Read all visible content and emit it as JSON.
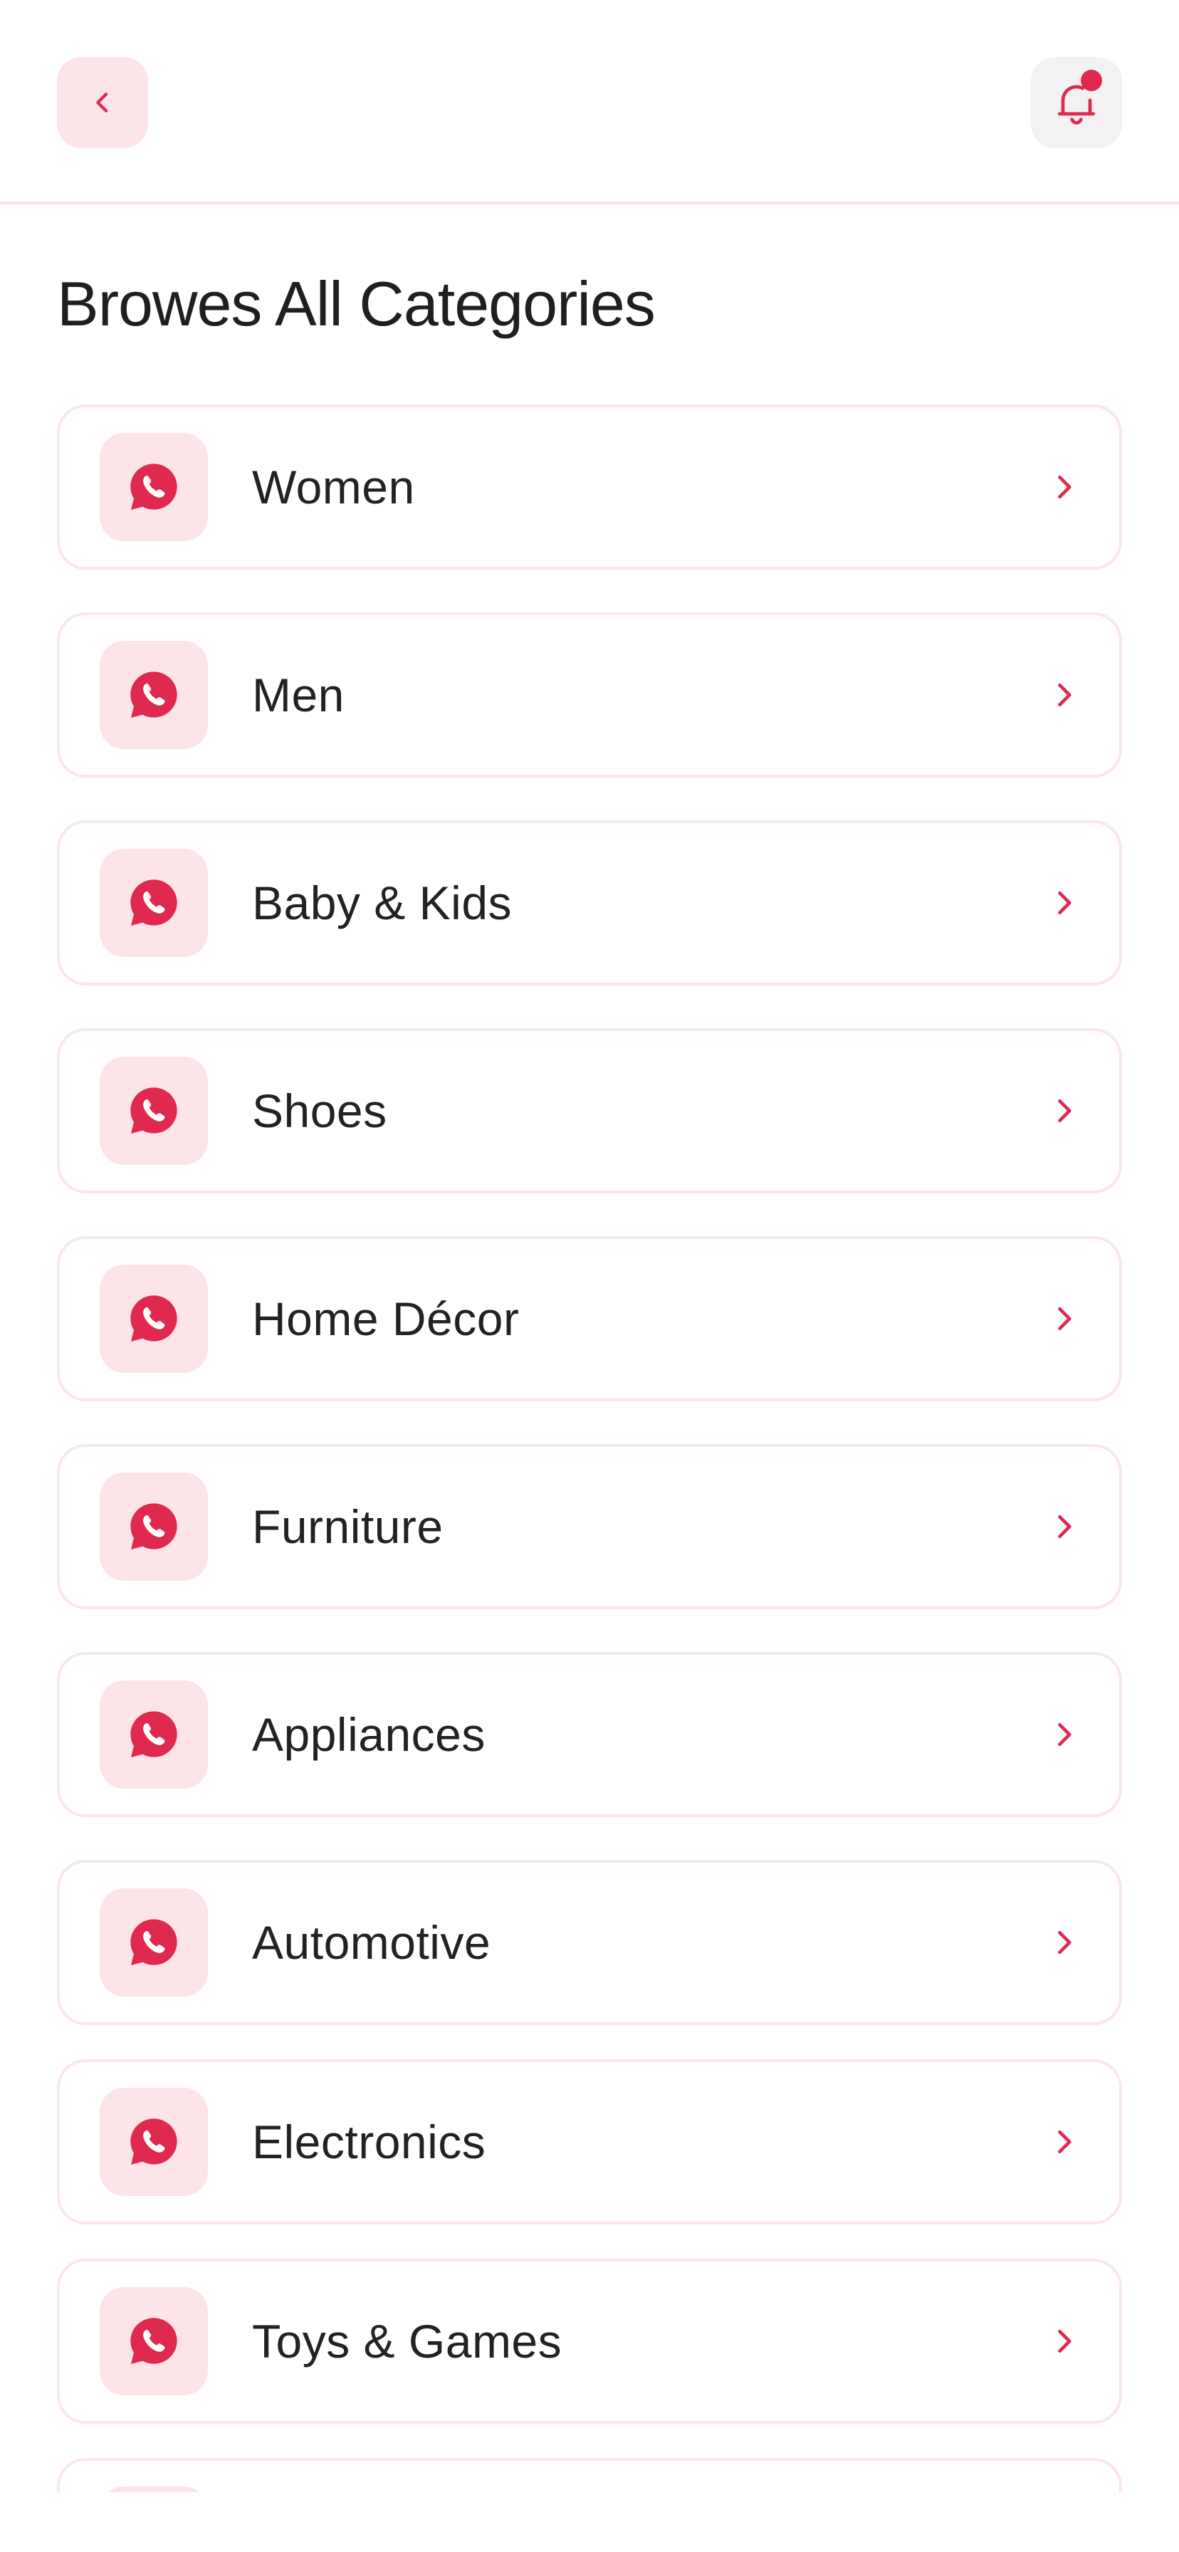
{
  "header": {
    "back_icon": "chevron-left-icon",
    "notification_icon": "bell-icon",
    "has_unread": true
  },
  "page": {
    "title": "Browes All Categories"
  },
  "colors": {
    "accent": "#e0294f",
    "accent_soft": "#fde4e9",
    "border": "#fbe6ea",
    "text": "#222226"
  },
  "categories": [
    {
      "label": "Women",
      "icon": "whatsapp-chat-icon"
    },
    {
      "label": "Men",
      "icon": "whatsapp-chat-icon"
    },
    {
      "label": "Baby & Kids",
      "icon": "whatsapp-chat-icon"
    },
    {
      "label": "Shoes",
      "icon": "whatsapp-chat-icon"
    },
    {
      "label": "Home Décor",
      "icon": "whatsapp-chat-icon"
    },
    {
      "label": "Furniture",
      "icon": "whatsapp-chat-icon"
    },
    {
      "label": "Appliances",
      "icon": "whatsapp-chat-icon"
    },
    {
      "label": "Automotive",
      "icon": "whatsapp-chat-icon"
    },
    {
      "label": "Electronics",
      "icon": "whatsapp-chat-icon"
    },
    {
      "label": "Toys & Games",
      "icon": "whatsapp-chat-icon"
    },
    {
      "label": "",
      "icon": "whatsapp-chat-icon"
    }
  ]
}
